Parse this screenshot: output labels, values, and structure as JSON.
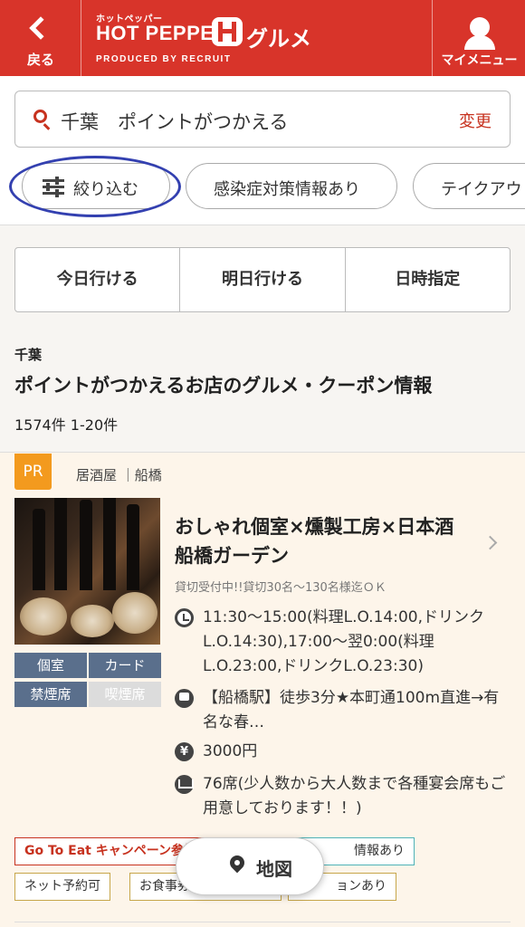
{
  "header": {
    "back_label": "戻る",
    "logo_kana": "ホットペッパー",
    "logo_main": "HOT PEPPER",
    "logo_gurume": "グルメ",
    "logo_produced": "PRODUCED BY RECRUIT",
    "mypage_label": "マイメニュー",
    "brand_color": "#d8342a"
  },
  "search": {
    "query": "千葉　ポイントがつかえる",
    "change_label": "変更"
  },
  "filters": {
    "narrow_label": "絞り込む",
    "chips": [
      "感染症対策情報あり",
      "テイクアウト"
    ]
  },
  "date_buttons": [
    "今日行ける",
    "明日行ける",
    "日時指定"
  ],
  "results": {
    "area": "千葉",
    "title": "ポイントがつかえるお店のグルメ・クーポン情報",
    "count": "1574件 1-20件"
  },
  "shop": {
    "pr_badge": "PR",
    "genre_line": "居酒屋 ｜船橋",
    "name": "おしゃれ個室×燻製工房×日本酒　船橋ガーデン",
    "catch": "貸切受付中!!貸切30名〜130名様迄ＯＫ",
    "hours": "11:30〜15:00(料理L.O.14:00,ドリンクL.O.14:30),17:00〜翌0:00(料理L.O.23:00,ドリンクL.O.23:30)",
    "access": "【船橋駅】徒歩3分★本町通100m直進→有名な春…",
    "budget": "3000円",
    "seats": "76席(少人数から大人数まで各種宴会席もご用意しております！！)",
    "tags": [
      {
        "label": "個室",
        "active": true
      },
      {
        "label": "カード",
        "active": true
      },
      {
        "label": "禁煙席",
        "active": true
      },
      {
        "label": "喫煙席",
        "active": false
      }
    ],
    "campaign_tags": {
      "goto": "Go To Eat キャンペーン参加店",
      "info": "情報あり",
      "net": "ネット予約可",
      "meal": "お食事券",
      "ok": "ョンあり"
    },
    "yen_symbol": "¥"
  },
  "map_button": {
    "label": "地図"
  }
}
